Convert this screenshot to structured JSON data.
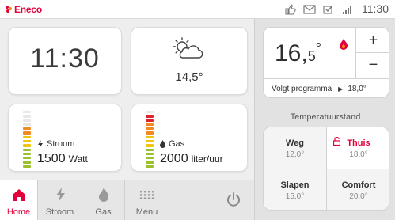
{
  "topbar": {
    "brand": "Eneco",
    "time": "11:30",
    "status_icons": [
      "thumbs-up-icon",
      "mail-icon",
      "shield-check-icon",
      "signal-icon"
    ]
  },
  "tiles": {
    "clock": {
      "time": "11:30"
    },
    "weather": {
      "icon": "partly-cloudy-icon",
      "temperature": "14,5°"
    },
    "power": {
      "label": "Stroom",
      "value": "1500",
      "unit": "Watt",
      "level": 0.7
    },
    "gas": {
      "label": "Gas",
      "value": "2000",
      "unit": "liter/uur",
      "level": 0.9
    }
  },
  "nav": {
    "items": [
      {
        "label": "Home",
        "icon": "home-icon",
        "active": true
      },
      {
        "label": "Stroom",
        "icon": "bolt-icon",
        "active": false
      },
      {
        "label": "Gas",
        "icon": "flame-icon",
        "active": false
      },
      {
        "label": "Menu",
        "icon": "grid-icon",
        "active": false
      }
    ],
    "power_icon": "power-icon"
  },
  "thermostat": {
    "setpoint_int": "16,",
    "setpoint_dec": "5",
    "deg": "°",
    "plus": "+",
    "minus": "−",
    "program_label": "Volgt programma",
    "program_arrow": "▶",
    "program_value": "18,0°"
  },
  "presets": {
    "title": "Temperatuurstand",
    "items": [
      {
        "name": "Weg",
        "temp": "12,0°"
      },
      {
        "name": "Thuis",
        "temp": "18,0°"
      },
      {
        "name": "Slapen",
        "temp": "15,0°"
      },
      {
        "name": "Comfort",
        "temp": "20,0°"
      }
    ]
  },
  "colors": {
    "brand": "#e4003b",
    "meter_green": "#9ac12c",
    "meter_yellow": "#f1c40f",
    "meter_orange": "#f08a24",
    "meter_red": "#d9262c",
    "meter_empty": "#e8e8e8"
  }
}
